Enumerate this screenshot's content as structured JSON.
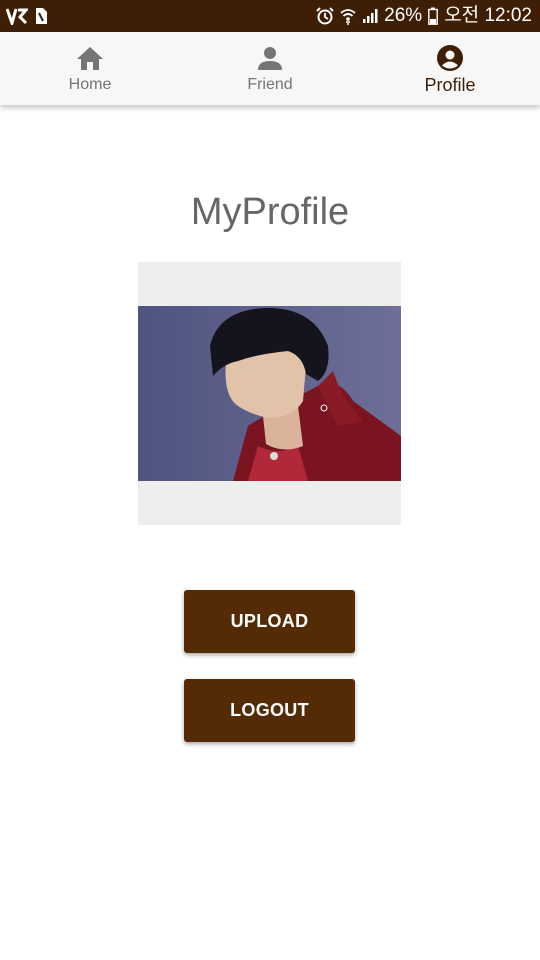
{
  "status_bar": {
    "battery": "26%",
    "time": "오전 12:02",
    "icons": [
      "v3-app-icon",
      "sim-icon",
      "alarm-icon",
      "wifi-icon",
      "signal-icon",
      "battery-icon"
    ]
  },
  "nav": {
    "tabs": [
      {
        "label": "Home",
        "icon": "home-icon",
        "active": false
      },
      {
        "label": "Friend",
        "icon": "person-icon",
        "active": false
      },
      {
        "label": "Profile",
        "icon": "account-circle-icon",
        "active": true
      }
    ]
  },
  "main": {
    "title": "MyProfile",
    "photo": "profile-photo",
    "upload_label": "UPLOAD",
    "logout_label": "LOGOUT"
  },
  "colors": {
    "accent": "#3e1f05",
    "button": "#552b05",
    "nav_bg": "#f7f7f7",
    "inactive": "#757575"
  }
}
